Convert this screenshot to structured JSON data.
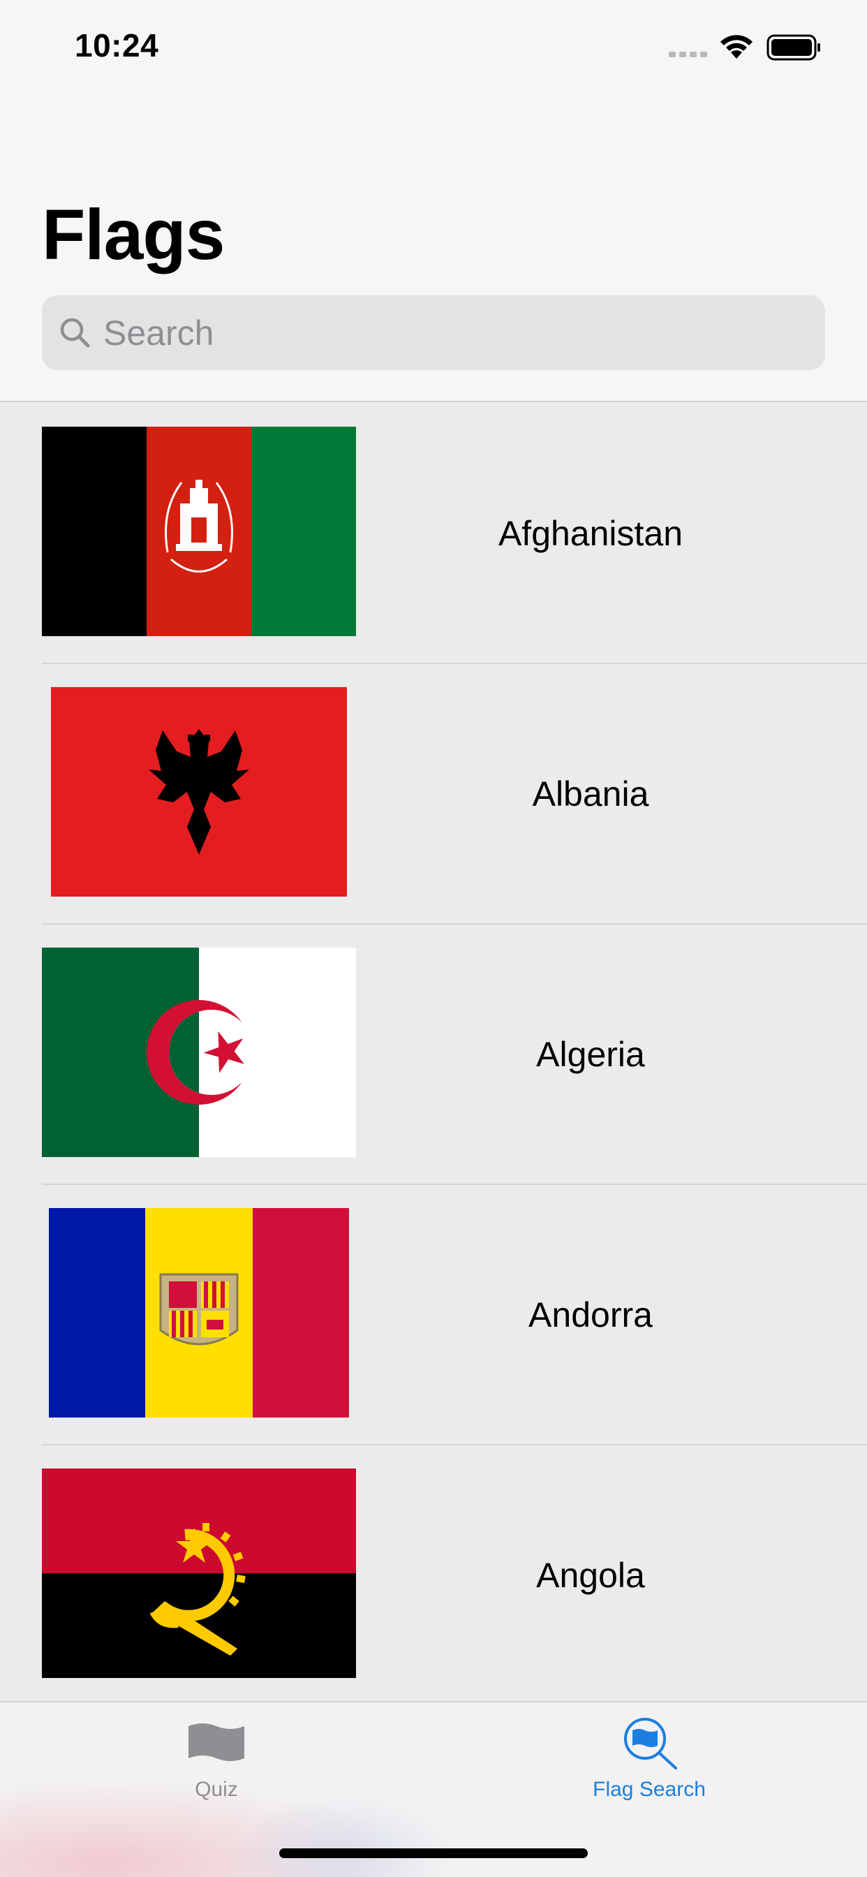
{
  "status_bar": {
    "time": "10:24"
  },
  "nav": {
    "title": "Flags"
  },
  "search": {
    "placeholder": "Search",
    "value": ""
  },
  "countries": [
    {
      "name": "Afghanistan"
    },
    {
      "name": "Albania"
    },
    {
      "name": "Algeria"
    },
    {
      "name": "Andorra"
    },
    {
      "name": "Angola"
    }
  ],
  "tabbar": {
    "tabs": [
      {
        "label": "Quiz",
        "icon": "flag-icon",
        "selected": false
      },
      {
        "label": "Flag Search",
        "icon": "flag-search-icon",
        "selected": true
      }
    ]
  },
  "colors": {
    "accent": "#1a7fe0",
    "tab_inactive": "#8e8e93",
    "background": "#ebebeb",
    "header_background": "#f6f6f6"
  }
}
